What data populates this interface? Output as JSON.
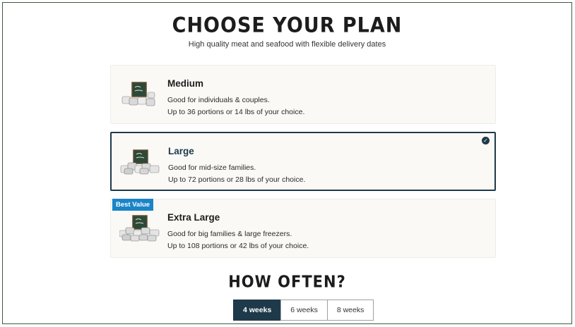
{
  "header": {
    "title": "CHOOSE YOUR PLAN",
    "subtitle": "High quality meat and seafood with flexible delivery dates"
  },
  "plans": [
    {
      "name": "Medium",
      "line1": "Good for individuals & couples.",
      "line2": "Up to 36 portions or 14 lbs of your choice.",
      "selected": false
    },
    {
      "name": "Large",
      "line1": "Good for mid-size families.",
      "line2": "Up to 72 portions or 28 lbs of your choice.",
      "selected": true
    },
    {
      "name": "Extra Large",
      "line1": "Good for big families & large freezers.",
      "line2": "Up to 108 portions or 42 lbs of your choice.",
      "badge": "Best Value",
      "selected": false
    }
  ],
  "frequency": {
    "title": "HOW OFTEN?",
    "options": [
      "4 weeks",
      "6 weeks",
      "8 weeks"
    ],
    "selected": "4 weeks"
  },
  "colors": {
    "accent": "#1e3a4a",
    "badge": "#1a84c7",
    "card": "#faf9f6"
  },
  "icons": {
    "check": "check-circle-icon",
    "box": "meat-box-icon"
  }
}
